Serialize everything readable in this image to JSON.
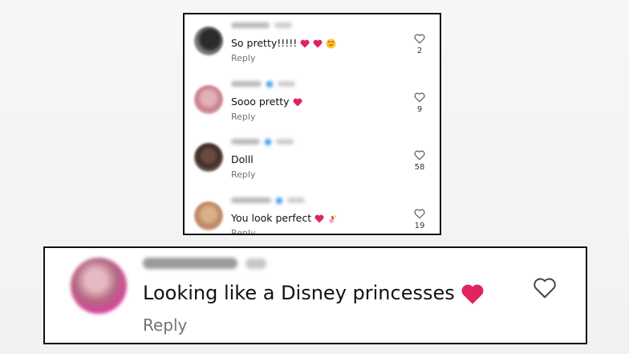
{
  "colors": {
    "text": "#111111",
    "muted": "#737373",
    "heart": "#e0245e",
    "verified": "#3897f0",
    "border": "#111111"
  },
  "top_comments": [
    {
      "text": "So pretty!!!!!",
      "emoji": [
        "heart",
        "heart",
        "smiling-face-with-heart-eyes"
      ],
      "reply": "Reply",
      "likes": "2",
      "verified": false
    },
    {
      "text": "Sooo pretty",
      "emoji": [
        "heart"
      ],
      "reply": "Reply",
      "likes": "9",
      "verified": true
    },
    {
      "text": "Dolll",
      "emoji": [],
      "reply": "Reply",
      "likes": "58",
      "verified": true
    },
    {
      "text": "You look perfect",
      "emoji": [
        "heart",
        "nail-polish"
      ],
      "reply": "Reply",
      "likes": "19",
      "verified": true
    }
  ],
  "featured_comment": {
    "username": "nishiseema",
    "time": "2s",
    "text": "Looking like a Disney princesses",
    "emoji": [
      "heart"
    ],
    "reply": "Reply"
  }
}
